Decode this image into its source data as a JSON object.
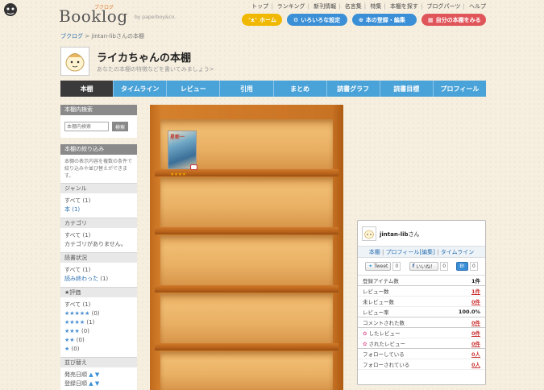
{
  "logo": {
    "text": "Booklog",
    "ruby": "ブクログ",
    "by": "by paperboy&co."
  },
  "top_links": [
    "トップ",
    "ランキング",
    "新刊情報",
    "名言集",
    "特集",
    "本棚を探す",
    "ブログパーツ",
    "ヘルプ"
  ],
  "top_buttons": {
    "home": "ホーム",
    "settings": "いろいろな設定",
    "register": "本の登録・編集",
    "mine": "自分の本棚をみる"
  },
  "breadcrumb": {
    "root": "ブクログ",
    "current": "jintan-libさんの本棚"
  },
  "shelf_header": {
    "title": "ライカちゃんの本棚",
    "description": "あなたの本棚の特徴などを書いてみましょう>"
  },
  "nav": {
    "tabs": [
      "本棚",
      "タイムライン",
      "レビュー",
      "引用",
      "まとめ",
      "読書グラフ",
      "読書目標",
      "プロフィール"
    ]
  },
  "sidebar": {
    "search_head": "本棚内検索",
    "search_placeholder": "本棚内検索",
    "search_button": "検索",
    "filter_head": "本棚の絞り込み",
    "filter_note": "本棚の表示内容を複数の条件で絞り込みや並び替えができます。",
    "genre_head": "ジャンル",
    "genre_all": "すべて (1)",
    "genre_book": "本 (1)",
    "category_head": "カテゴリ",
    "category_all": "すべて (1)",
    "category_none": "カテゴリがありません。",
    "status_head": "読書状況",
    "status_all": "すべて (1)",
    "status_read": "読み終わった",
    "status_read_count": " (1)",
    "rating_head": "★評価",
    "rating_all": "すべて (1)",
    "rating_5": "★★★★★",
    "rating_5_count": " (0)",
    "rating_4": "★★★★",
    "rating_4_count": " (1)",
    "rating_3": "★★★",
    "rating_3_count": " (0)",
    "rating_2": "★★",
    "rating_2_count": " (0)",
    "rating_1": "★",
    "rating_1_count": " (0)",
    "sort_head": "並び替え",
    "sort_release": "発売日順",
    "sort_registered": "登録日順",
    "sort_arrows": "▲ ▼"
  },
  "book": {
    "title_fragment": "星新一",
    "stars": "★★★★"
  },
  "profile": {
    "name": "jintan-lib",
    "suffix": "さん",
    "links": [
      "本棚",
      "プロフィール",
      "[編集]",
      "タイムライン"
    ],
    "tweet_label": "Tweet",
    "tweet_count": "0",
    "like_label": "いいね！",
    "like_count": "0",
    "hatena_label": "B!",
    "hatena_count": "0",
    "stats": [
      {
        "label": "登録アイテム数",
        "value": "1件"
      },
      {
        "label": "レビュー数",
        "value": "1件"
      },
      {
        "label": "未レビュー数",
        "value": "0件"
      },
      {
        "label": "レビュー率",
        "value": "100.0%"
      },
      {
        "label": "コメントされた数",
        "value": "0件"
      },
      {
        "label": "したレビュー",
        "value": "0件"
      },
      {
        "label": "されたレビュー",
        "value": "0件"
      },
      {
        "label": "フォローしている",
        "value": "0人"
      },
      {
        "label": "フォローされている",
        "value": "0人"
      }
    ]
  }
}
